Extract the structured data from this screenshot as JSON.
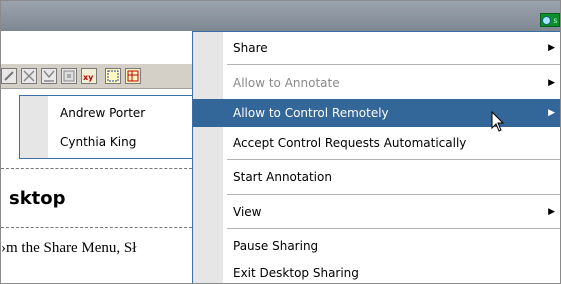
{
  "menu": {
    "items": [
      {
        "label": "Share",
        "has_submenu": true,
        "state": "normal"
      },
      {
        "label": "Allow to Annotate",
        "has_submenu": true,
        "state": "disabled"
      },
      {
        "label": "Allow to Control Remotely",
        "has_submenu": true,
        "state": "highlighted"
      },
      {
        "label": "Accept Control Requests Automatically",
        "has_submenu": false,
        "state": "normal"
      },
      {
        "label": "Start Annotation",
        "has_submenu": false,
        "state": "normal"
      },
      {
        "label": "View",
        "has_submenu": true,
        "state": "normal"
      },
      {
        "label": "Pause Sharing",
        "has_submenu": false,
        "state": "normal"
      },
      {
        "label": "Exit Desktop Sharing",
        "has_submenu": false,
        "state": "normal"
      }
    ]
  },
  "submenu": {
    "users": [
      {
        "name": "Andrew Porter"
      },
      {
        "name": "Cynthia King"
      }
    ]
  },
  "page": {
    "heading": "sktop",
    "body_text": "›m the Share Menu, Sł"
  },
  "icons": {
    "submenu_arrow": "submenu-arrow-icon",
    "cursor": "mouse-pointer-icon",
    "sharing_indicator": "sharing-indicator-icon"
  },
  "colors": {
    "highlight": "#336699",
    "menu_border": "#3a6ea5",
    "gutter": "#e6e6e6",
    "disabled_text": "#8a8a8a",
    "indicator": "#0a8f2a"
  }
}
